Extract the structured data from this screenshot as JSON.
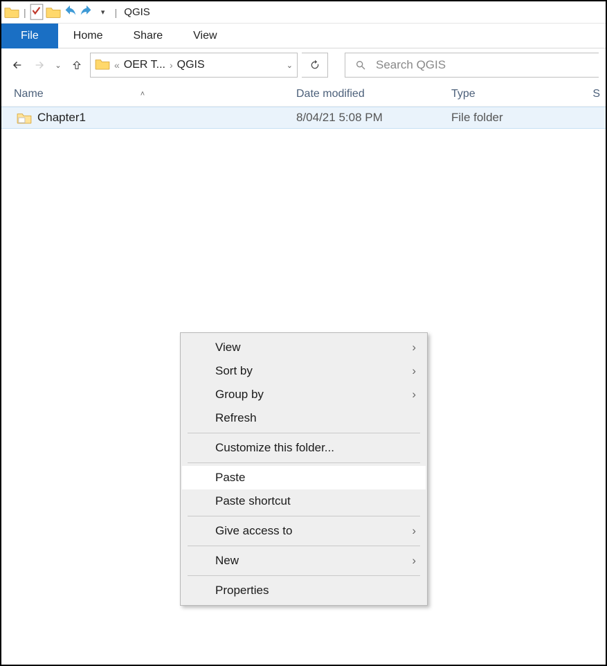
{
  "title_bar": {
    "app_title": "QGIS"
  },
  "ribbon": {
    "file": "File",
    "home": "Home",
    "share": "Share",
    "view": "View"
  },
  "address": {
    "seg1": "OER T...",
    "seg2": "QGIS"
  },
  "search": {
    "placeholder": "Search QGIS"
  },
  "columns": {
    "name": "Name",
    "date_modified": "Date modified",
    "type": "Type",
    "size": "S"
  },
  "rows": [
    {
      "name": "Chapter1",
      "date": "8/04/21 5:08 PM",
      "type": "File folder"
    }
  ],
  "context_menu": {
    "view": "View",
    "sort_by": "Sort by",
    "group_by": "Group by",
    "refresh": "Refresh",
    "customize": "Customize this folder...",
    "paste": "Paste",
    "paste_shortcut": "Paste shortcut",
    "give_access": "Give access to",
    "new": "New",
    "properties": "Properties"
  }
}
